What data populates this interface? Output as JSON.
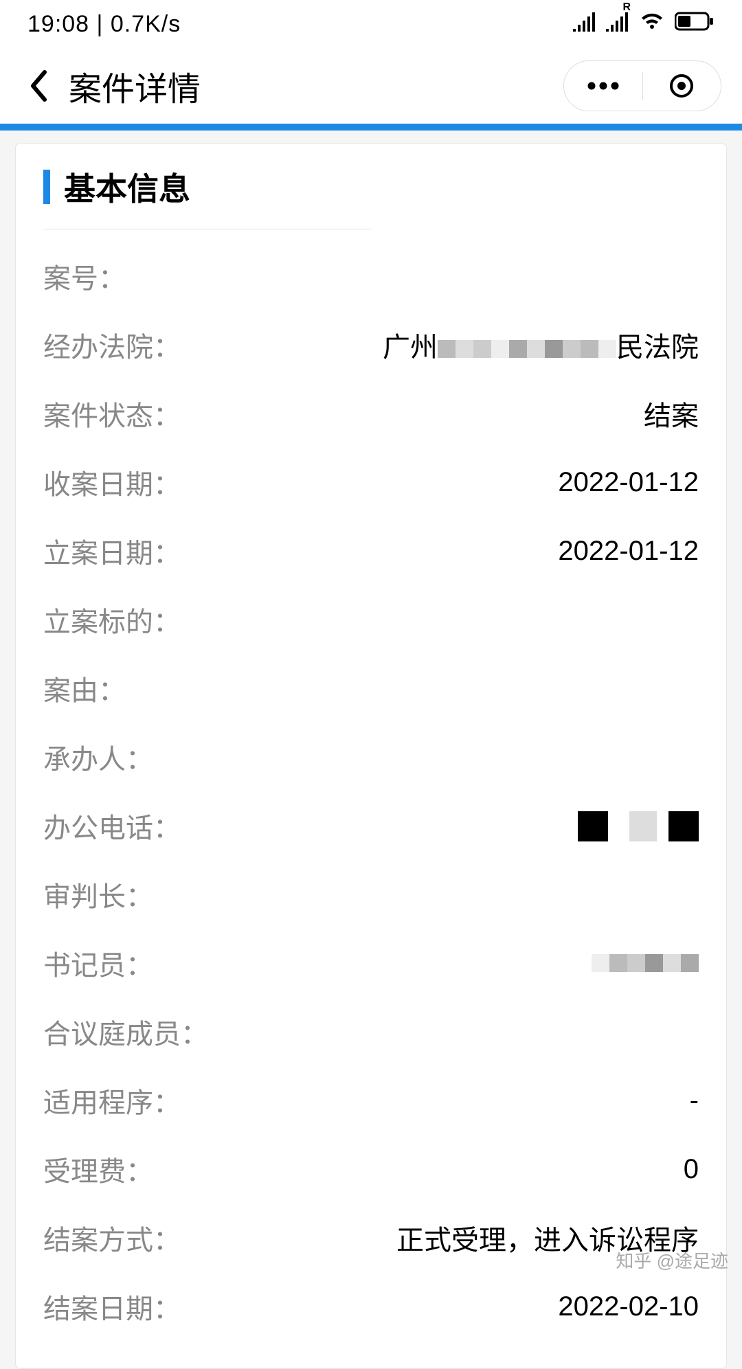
{
  "status_bar": {
    "time": "19:08",
    "speed": "0.7K/s"
  },
  "header": {
    "title": "案件详情"
  },
  "section": {
    "title": "基本信息"
  },
  "fields": {
    "case_no": {
      "label": "案号：",
      "value": ""
    },
    "court": {
      "label": "经办法院：",
      "value_prefix": "广州",
      "value_suffix": "民法院"
    },
    "status": {
      "label": "案件状态：",
      "value": "结案"
    },
    "receive_date": {
      "label": "收案日期：",
      "value": "2022-01-12"
    },
    "filing_date": {
      "label": "立案日期：",
      "value": "2022-01-12"
    },
    "subject": {
      "label": "立案标的：",
      "value": ""
    },
    "cause": {
      "label": "案由：",
      "value": ""
    },
    "handler": {
      "label": "承办人：",
      "value": ""
    },
    "phone": {
      "label": "办公电话：",
      "value": ""
    },
    "judge": {
      "label": "审判长：",
      "value": ""
    },
    "clerk": {
      "label": "书记员：",
      "value": ""
    },
    "panel": {
      "label": "合议庭成员：",
      "value": ""
    },
    "procedure": {
      "label": "适用程序：",
      "value": "-"
    },
    "fee": {
      "label": "受理费：",
      "value": "0"
    },
    "close_method": {
      "label": "结案方式：",
      "value": "正式受理，进入诉讼程序"
    },
    "close_date": {
      "label": "结案日期：",
      "value": "2022-02-10"
    }
  },
  "watermark": "知乎 @途足迹"
}
